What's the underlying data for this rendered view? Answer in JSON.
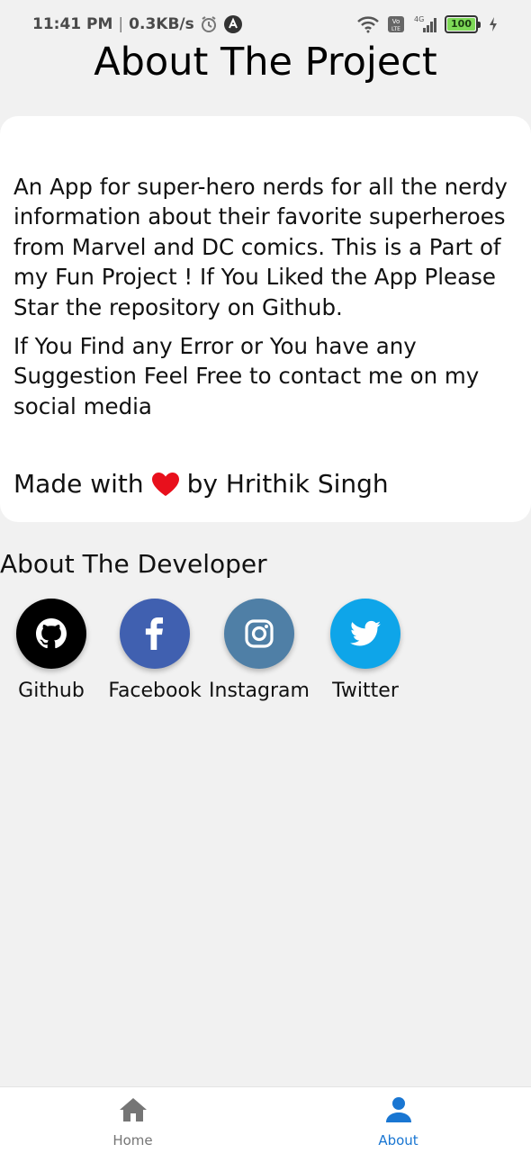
{
  "status_bar": {
    "time": "11:41 PM",
    "separator": "|",
    "speed": "0.3KB/s",
    "network_type": "4G",
    "battery_level": "100"
  },
  "page": {
    "title": "About The Project"
  },
  "project_card": {
    "paragraph1": "An App for super-hero nerds for all the nerdy information about their favorite superheroes from Marvel and DC comics. This is a Part of my Fun Project ! If You Liked the App Please Star the repository on Github.",
    "paragraph2": "If You Find any Error or You have any Suggestion Feel Free to contact me on my social media",
    "made_with_prefix": "Made with",
    "made_with_suffix": "by Hrithik Singh"
  },
  "developer": {
    "heading": "About The Developer",
    "links": [
      {
        "label": "Github",
        "icon": "github-icon",
        "color": "#000000"
      },
      {
        "label": "Facebook",
        "icon": "facebook-icon",
        "color": "#4060b0"
      },
      {
        "label": "Instagram",
        "icon": "instagram-icon",
        "color": "#4f7fa6"
      },
      {
        "label": "Twitter",
        "icon": "twitter-icon",
        "color": "#0ea5e9"
      }
    ]
  },
  "bottom_nav": {
    "items": [
      {
        "label": "Home",
        "icon": "home-icon",
        "active": false
      },
      {
        "label": "About",
        "icon": "person-icon",
        "active": true
      }
    ]
  },
  "colors": {
    "background": "#f1f1f1",
    "card": "#ffffff",
    "heart": "#e8101c",
    "active_tab": "#1976d2",
    "inactive_tab": "#757575"
  }
}
